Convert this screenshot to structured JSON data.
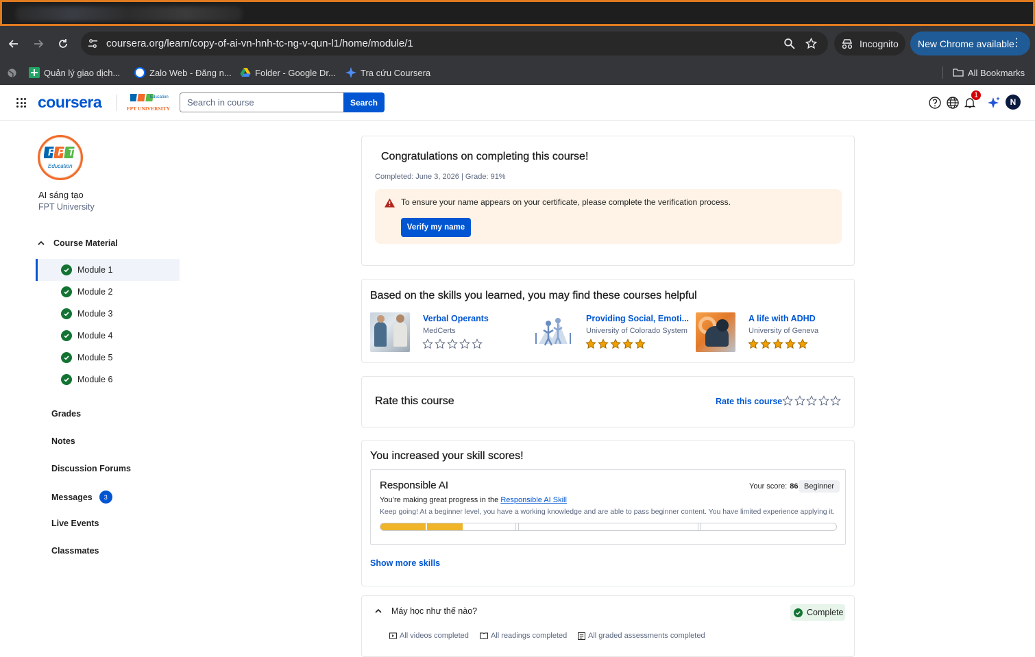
{
  "browser": {
    "url": "coursera.org/learn/copy-of-ai-vn-hnh-tc-ng-v-qun-l1/home/module/1",
    "incognito_label": "Incognito",
    "update_label": "New Chrome available",
    "bookmarks": [
      {
        "label": "Quản lý giao dịch..."
      },
      {
        "label": "Zalo Web - Đăng n..."
      },
      {
        "label": "Folder - Google Dr..."
      },
      {
        "label": "Tra cứu Coursera"
      }
    ],
    "all_bookmarks": "All Bookmarks"
  },
  "header": {
    "logo": "coursera",
    "partner_text": "Education",
    "partner_name": "FPT UNIVERSITY",
    "search_placeholder": "Search in course",
    "search_button": "Search",
    "notification_count": "1",
    "avatar_initial": "N"
  },
  "sidebar": {
    "logo_text": "FPT",
    "logo_sub": "Education",
    "course_name": "AI sáng tạo",
    "org": "FPT University",
    "section": "Course Material",
    "modules": [
      {
        "label": "Module 1",
        "active": true
      },
      {
        "label": "Module 2"
      },
      {
        "label": "Module 3"
      },
      {
        "label": "Module 4"
      },
      {
        "label": "Module 5"
      },
      {
        "label": "Module 6"
      }
    ],
    "nav": {
      "grades": "Grades",
      "notes": "Notes",
      "forums": "Discussion Forums",
      "messages": "Messages",
      "messages_count": "3",
      "live": "Live Events",
      "classmates": "Classmates"
    }
  },
  "congrats": {
    "title": "Congratulations on completing this course!",
    "meta": "Completed: June 3, 2026 | Grade: 91%",
    "warning": "To ensure your name appears on your certificate, please complete the verification process.",
    "verify_button": "Verify my name"
  },
  "recommendations": {
    "title": "Based on the skills you learned, you may find these courses helpful",
    "items": [
      {
        "title": "Verbal Operants",
        "provider": "MedCerts",
        "rating": 0
      },
      {
        "title": "Providing Social, Emoti...",
        "provider": "University of Colorado System",
        "rating": 5
      },
      {
        "title": "A life with ADHD",
        "provider": "University of Geneva",
        "rating": 5
      }
    ]
  },
  "rate": {
    "title": "Rate this course",
    "link": "Rate this course"
  },
  "skills": {
    "title": "You increased your skill scores!",
    "skill_name": "Responsible AI",
    "score_label": "Your score:",
    "score": "86",
    "level": "Beginner",
    "progress_text": "You’re making great progress in the",
    "skill_link": "Responsible AI Skill",
    "description": "Keep going! At a beginner level, you have a working knowledge and are able to pass beginner content. You have limited experience applying it.",
    "bar_fill_fraction": 0.18,
    "show_more": "Show more skills"
  },
  "module_summary": {
    "title": "Máy học như thế nào?",
    "status": "Complete",
    "criteria": [
      "All videos completed",
      "All readings completed",
      "All graded assessments completed"
    ]
  },
  "colors": {
    "accent": "#0056d2",
    "success": "#137333",
    "star": "#f0a000",
    "brand_orange": "#f26b2a"
  }
}
